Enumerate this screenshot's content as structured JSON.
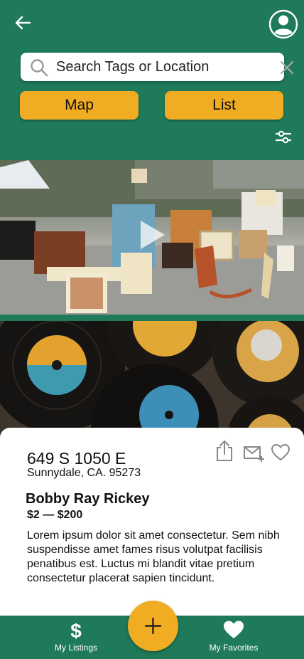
{
  "header": {
    "back_icon": "arrow-left-icon",
    "avatar_icon": "user-circle-icon"
  },
  "search": {
    "placeholder": "Search Tags or Location",
    "value": "",
    "search_icon": "magnifier-icon",
    "clear_icon": "close-icon"
  },
  "tabs": {
    "map_label": "Map",
    "list_label": "List"
  },
  "filter_icon": "sliders-icon",
  "listings": [
    {
      "image": "yard-sale-furniture-photo",
      "play_icon": "play-icon"
    },
    {
      "image": "vinyl-records-photo"
    }
  ],
  "card": {
    "address_line1": "649 S 1050 E",
    "address_line2": "Sunnydale, CA. 95273",
    "seller_name": "Bobby Ray Rickey",
    "price_range": "$2 — $200",
    "description": "Lorem ipsum dolor sit amet consectetur. Sem nibh suspendisse amet fames risus volutpat facilisis penatibus est. Luctus mi blandit vitae pretium consectetur placerat sapien tincidunt.",
    "share_icon": "share-icon",
    "mail_icon": "mail-plus-icon",
    "favorite_icon": "heart-outline-icon"
  },
  "bottom_nav": {
    "listings_label": "My Listings",
    "favorites_label": "My Favorites",
    "add_icon": "plus-icon"
  },
  "colors": {
    "primary_green": "#1f7a5a",
    "accent_yellow": "#f0ac23"
  }
}
